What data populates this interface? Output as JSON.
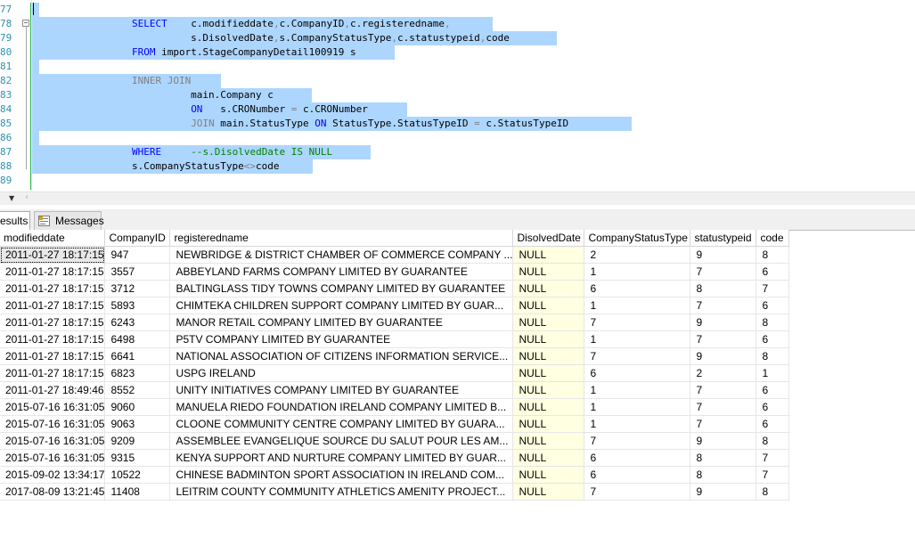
{
  "editor": {
    "lines": [
      {
        "num": "77",
        "parts": []
      },
      {
        "num": "78",
        "parts": [
          {
            "t": "                ",
            "c": ""
          },
          {
            "t": "SELECT",
            "c": "kw"
          },
          {
            "t": "    c.modifieddate",
            "c": ""
          },
          {
            "t": ",",
            "c": "gry"
          },
          {
            "t": "c.CompanyID",
            "c": ""
          },
          {
            "t": ",",
            "c": "gry"
          },
          {
            "t": "c.registeredname",
            "c": ""
          },
          {
            "t": ",",
            "c": "gry"
          }
        ]
      },
      {
        "num": "79",
        "parts": [
          {
            "t": "                          s.DisolvedDate",
            "c": ""
          },
          {
            "t": ",",
            "c": "gry"
          },
          {
            "t": "s.CompanyStatusType",
            "c": ""
          },
          {
            "t": ",",
            "c": "gry"
          },
          {
            "t": "c.statustypeid",
            "c": ""
          },
          {
            "t": ",",
            "c": "gry"
          },
          {
            "t": "code",
            "c": ""
          }
        ]
      },
      {
        "num": "80",
        "parts": [
          {
            "t": "                ",
            "c": ""
          },
          {
            "t": "FROM",
            "c": "kw"
          },
          {
            "t": " import.StageCompanyDetail100919 s",
            "c": ""
          }
        ]
      },
      {
        "num": "81",
        "parts": []
      },
      {
        "num": "82",
        "parts": [
          {
            "t": "                ",
            "c": ""
          },
          {
            "t": "INNER JOIN",
            "c": "gry"
          }
        ]
      },
      {
        "num": "83",
        "parts": [
          {
            "t": "                          main.Company c",
            "c": ""
          }
        ]
      },
      {
        "num": "84",
        "parts": [
          {
            "t": "                          ",
            "c": ""
          },
          {
            "t": "ON",
            "c": "kw"
          },
          {
            "t": "   s.CRONumber ",
            "c": ""
          },
          {
            "t": "=",
            "c": "gry"
          },
          {
            "t": " c.CRONumber",
            "c": ""
          }
        ]
      },
      {
        "num": "85",
        "parts": [
          {
            "t": "                          ",
            "c": ""
          },
          {
            "t": "JOIN",
            "c": "gry"
          },
          {
            "t": " main.StatusType ",
            "c": ""
          },
          {
            "t": "ON",
            "c": "kw"
          },
          {
            "t": " StatusType.StatusTypeID ",
            "c": ""
          },
          {
            "t": "=",
            "c": "gry"
          },
          {
            "t": " c.StatusTypeID",
            "c": ""
          }
        ]
      },
      {
        "num": "86",
        "parts": []
      },
      {
        "num": "87",
        "parts": [
          {
            "t": "                ",
            "c": ""
          },
          {
            "t": "WHERE",
            "c": "kw"
          },
          {
            "t": "     ",
            "c": ""
          },
          {
            "t": "--s.DisolvedDate IS NULL",
            "c": "cmt"
          }
        ]
      },
      {
        "num": "88",
        "parts": [
          {
            "t": "                s.CompanyStatusType",
            "c": ""
          },
          {
            "t": "<>",
            "c": "gry"
          },
          {
            "t": "code",
            "c": ""
          }
        ]
      },
      {
        "num": "89",
        "parts": []
      }
    ]
  },
  "tabs": {
    "results_label": "esults",
    "messages_label": "Messages"
  },
  "grid": {
    "columns": [
      "modifieddate",
      "CompanyID",
      "registeredname",
      "DisolvedDate",
      "CompanyStatusType",
      "statustypeid",
      "code"
    ],
    "rows": [
      [
        "2011-01-27 18:17:15",
        "947",
        "NEWBRIDGE & DISTRICT CHAMBER OF COMMERCE COMPANY ...",
        "NULL",
        "2",
        "9",
        "8"
      ],
      [
        "2011-01-27 18:17:15",
        "3557",
        "ABBEYLAND FARMS COMPANY LIMITED BY GUARANTEE",
        "NULL",
        "1",
        "7",
        "6"
      ],
      [
        "2011-01-27 18:17:15",
        "3712",
        "BALTINGLASS TIDY TOWNS COMPANY LIMITED BY GUARANTEE",
        "NULL",
        "6",
        "8",
        "7"
      ],
      [
        "2011-01-27 18:17:15",
        "5893",
        "CHIMTEKA CHILDREN SUPPORT COMPANY LIMITED BY GUAR...",
        "NULL",
        "1",
        "7",
        "6"
      ],
      [
        "2011-01-27 18:17:15",
        "6243",
        "MANOR RETAIL COMPANY LIMITED BY GUARANTEE",
        "NULL",
        "7",
        "9",
        "8"
      ],
      [
        "2011-01-27 18:17:15",
        "6498",
        "P5TV COMPANY LIMITED BY GUARANTEE",
        "NULL",
        "1",
        "7",
        "6"
      ],
      [
        "2011-01-27 18:17:15",
        "6641",
        "NATIONAL ASSOCIATION OF CITIZENS INFORMATION SERVICE...",
        "NULL",
        "7",
        "9",
        "8"
      ],
      [
        "2011-01-27 18:17:15",
        "6823",
        "USPG IRELAND",
        "NULL",
        "6",
        "2",
        "1"
      ],
      [
        "2011-01-27 18:49:46",
        "8552",
        "UNITY INITIATIVES COMPANY LIMITED BY GUARANTEE",
        "NULL",
        "1",
        "7",
        "6"
      ],
      [
        "2015-07-16 16:31:05",
        "9060",
        "MANUELA RIEDO FOUNDATION IRELAND COMPANY LIMITED B...",
        "NULL",
        "1",
        "7",
        "6"
      ],
      [
        "2015-07-16 16:31:05",
        "9063",
        "CLOONE COMMUNITY CENTRE COMPANY LIMITED BY GUARA...",
        "NULL",
        "1",
        "7",
        "6"
      ],
      [
        "2015-07-16 16:31:05",
        "9209",
        "ASSEMBLEE EVANGELIQUE SOURCE DU SALUT POUR LES AM...",
        "NULL",
        "7",
        "9",
        "8"
      ],
      [
        "2015-07-16 16:31:05",
        "9315",
        "KENYA SUPPORT AND NURTURE COMPANY LIMITED BY GUAR...",
        "NULL",
        "6",
        "8",
        "7"
      ],
      [
        "2015-09-02 13:34:17",
        "10522",
        "CHINESE BADMINTON SPORT ASSOCIATION IN IRELAND COM...",
        "NULL",
        "6",
        "8",
        "7"
      ],
      [
        "2017-08-09 13:21:45",
        "11408",
        "LEITRIM COUNTY COMMUNITY ATHLETICS AMENITY PROJECT...",
        "NULL",
        "7",
        "9",
        "8"
      ]
    ]
  },
  "colors": {
    "selection": "#add6ff",
    "keyword": "#0000ff",
    "comment": "#008000",
    "null_cell": "#ffffe1"
  }
}
